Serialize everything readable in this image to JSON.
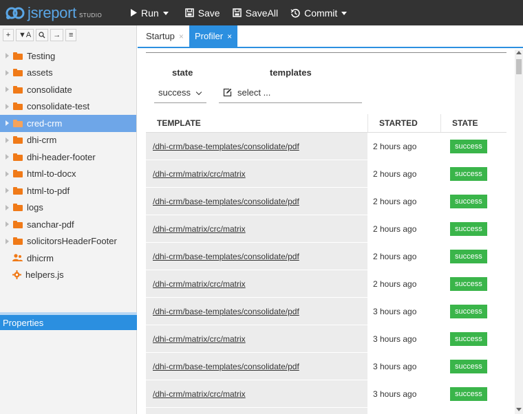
{
  "app": {
    "logo_text": "jsreport",
    "logo_sub": "STUDIO"
  },
  "toolbar": {
    "run_label": "Run",
    "save_label": "Save",
    "saveall_label": "SaveAll",
    "commit_label": "Commit"
  },
  "tree_toolbar": {
    "add": "+",
    "filter": "▼A",
    "search": "⌕",
    "forward": "→",
    "menu": "≡"
  },
  "tree": {
    "folders": [
      "Testing",
      "assets",
      "consolidate",
      "consolidate-test",
      "cred-crm",
      "dhi-crm",
      "dhi-header-footer",
      "html-to-docx",
      "html-to-pdf",
      "logs",
      "sanchar-pdf",
      "solicitorsHeaderFooter"
    ],
    "selected": "cred-crm",
    "user_item": "dhicrm",
    "script_item": "helpers.js"
  },
  "properties_label": "Properties",
  "tabs": [
    {
      "label": "Startup",
      "close": "×"
    },
    {
      "label": "Profiler",
      "close": "×"
    }
  ],
  "filters": {
    "state_label": "state",
    "templates_label": "templates",
    "state_value": "success",
    "templates_value": "select ..."
  },
  "grid": {
    "headers": [
      "TEMPLATE",
      "STARTED",
      "STATE"
    ],
    "rows": [
      {
        "template": "/dhi-crm/base-templates/consolidate/pdf",
        "started": "2 hours ago",
        "state": "success"
      },
      {
        "template": "/dhi-crm/matrix/crc/matrix",
        "started": "2 hours ago",
        "state": "success"
      },
      {
        "template": "/dhi-crm/base-templates/consolidate/pdf",
        "started": "2 hours ago",
        "state": "success"
      },
      {
        "template": "/dhi-crm/matrix/crc/matrix",
        "started": "2 hours ago",
        "state": "success"
      },
      {
        "template": "/dhi-crm/base-templates/consolidate/pdf",
        "started": "2 hours ago",
        "state": "success"
      },
      {
        "template": "/dhi-crm/matrix/crc/matrix",
        "started": "2 hours ago",
        "state": "success"
      },
      {
        "template": "/dhi-crm/base-templates/consolidate/pdf",
        "started": "3 hours ago",
        "state": "success"
      },
      {
        "template": "/dhi-crm/matrix/crc/matrix",
        "started": "3 hours ago",
        "state": "success"
      },
      {
        "template": "/dhi-crm/base-templates/consolidate/pdf",
        "started": "3 hours ago",
        "state": "success"
      },
      {
        "template": "/dhi-crm/matrix/crc/matrix",
        "started": "3 hours ago",
        "state": "success"
      }
    ]
  },
  "colors": {
    "accent": "#2b8fe0",
    "folder": "#f07a18",
    "success": "#3ab54a",
    "toolbar_bg": "#333333"
  }
}
